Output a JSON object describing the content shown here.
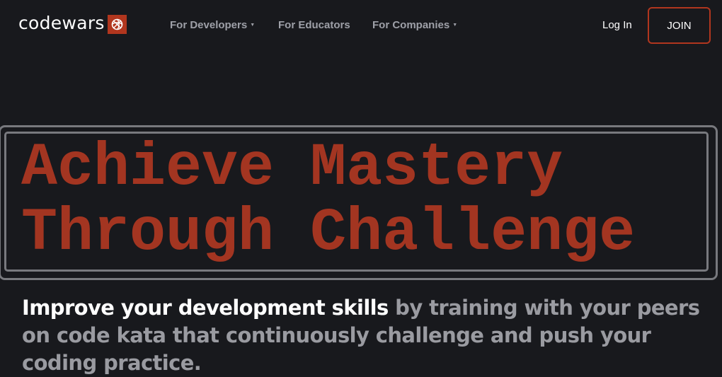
{
  "nav": {
    "logo_text": "codewars",
    "items": [
      {
        "label": "For Developers",
        "has_dropdown": true
      },
      {
        "label": "For Educators",
        "has_dropdown": false
      },
      {
        "label": "For Companies",
        "has_dropdown": true
      }
    ],
    "login_label": "Log In",
    "join_label": "JOIN"
  },
  "hero": {
    "headline_line1": "Achieve Mastery",
    "headline_line2": "Through Challenge",
    "tagline_strong": "Improve your development skills",
    "tagline_rest": " by training with your peers on code kata that continuously challenge and push your coding practice."
  },
  "icons": {
    "logo": "codewars-logo-icon",
    "dropdown": "caret-down-icon"
  },
  "colors": {
    "background": "#18191d",
    "accent": "#b1361e",
    "headline": "#a33521",
    "nav_text": "#9ea0a8",
    "frame": "#78797e"
  }
}
